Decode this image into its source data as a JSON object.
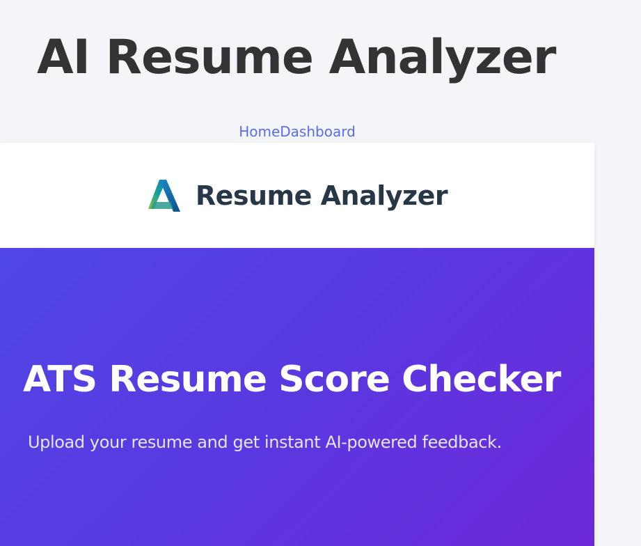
{
  "page": {
    "title": "AI Resume Analyzer"
  },
  "nav": {
    "home_label": "Home",
    "dashboard_label": "Dashboard",
    "link_color": "#5b6cf0"
  },
  "brand": {
    "name": "Resume Analyzer",
    "logo_icon": "autodesk-style-a-logo-icon"
  },
  "hero": {
    "title": "ATS Resume Score Checker",
    "subtitle": "Upload your resume and get instant AI-powered feedback.",
    "gradient_start": "#4f46e5",
    "gradient_end": "#6d28d9"
  }
}
